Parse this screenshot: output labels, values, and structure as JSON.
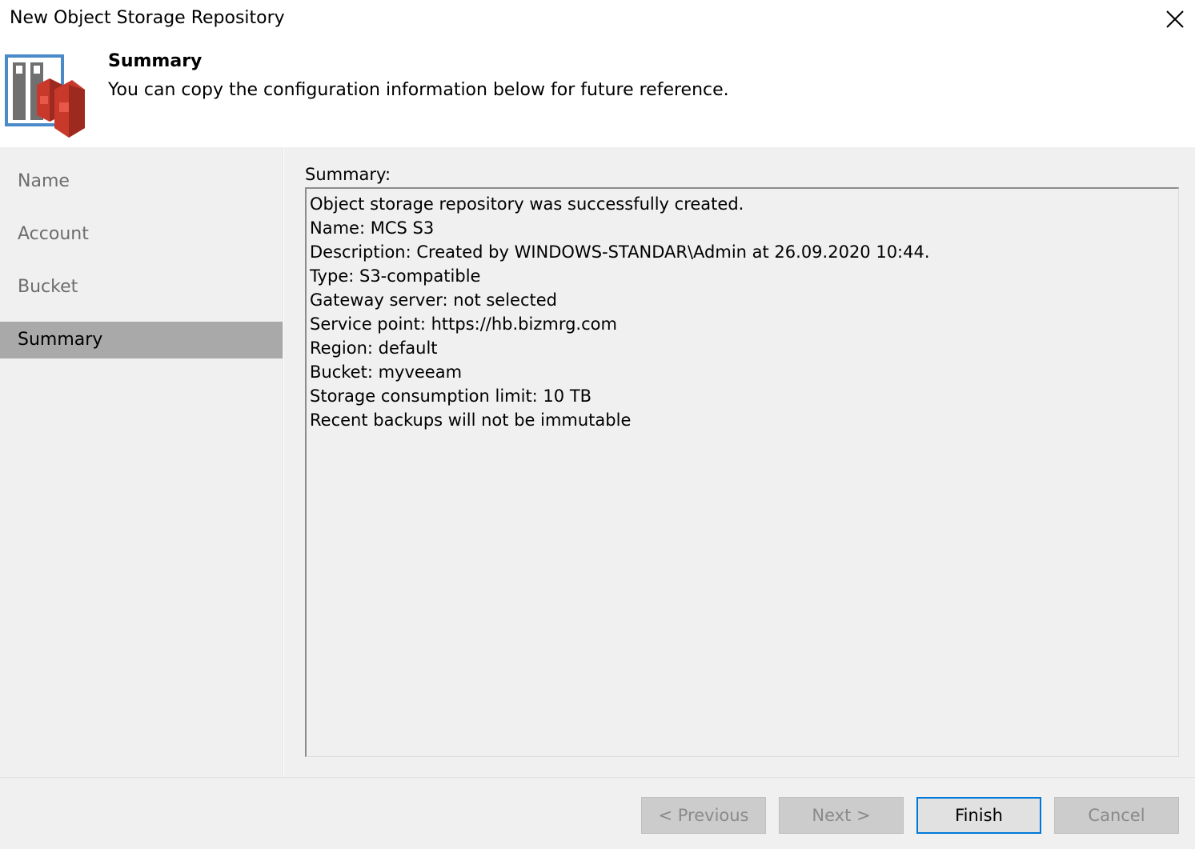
{
  "window": {
    "title": "New Object Storage Repository"
  },
  "header": {
    "title": "Summary",
    "subtitle": "You can copy the configuration information below for future reference."
  },
  "steps": [
    {
      "label": "Name",
      "active": false
    },
    {
      "label": "Account",
      "active": false
    },
    {
      "label": "Bucket",
      "active": false
    },
    {
      "label": "Summary",
      "active": true
    }
  ],
  "summary": {
    "label": "Summary:",
    "lines": [
      "Object storage repository was successfully created.",
      "Name: MCS S3",
      "Description: Created by WINDOWS-STANDAR\\Admin at 26.09.2020 10:44.",
      "Type: S3-compatible",
      "Gateway server: not selected",
      "Service point: https://hb.bizmrg.com",
      "Region: default",
      "Bucket: myveeam",
      "Storage consumption limit: 10 TB",
      "Recent backups will not be immutable"
    ]
  },
  "buttons": {
    "previous": "< Previous",
    "next": "Next >",
    "finish": "Finish",
    "cancel": "Cancel"
  },
  "icons": {
    "close": "close-icon",
    "header": "object-storage-repository-icon"
  },
  "colors": {
    "accent": "#0078d7",
    "active_step": "#a9a9a9",
    "panel": "#f0f0f0",
    "icon_red": "#c8392b",
    "icon_blue": "#4a8ac8"
  }
}
